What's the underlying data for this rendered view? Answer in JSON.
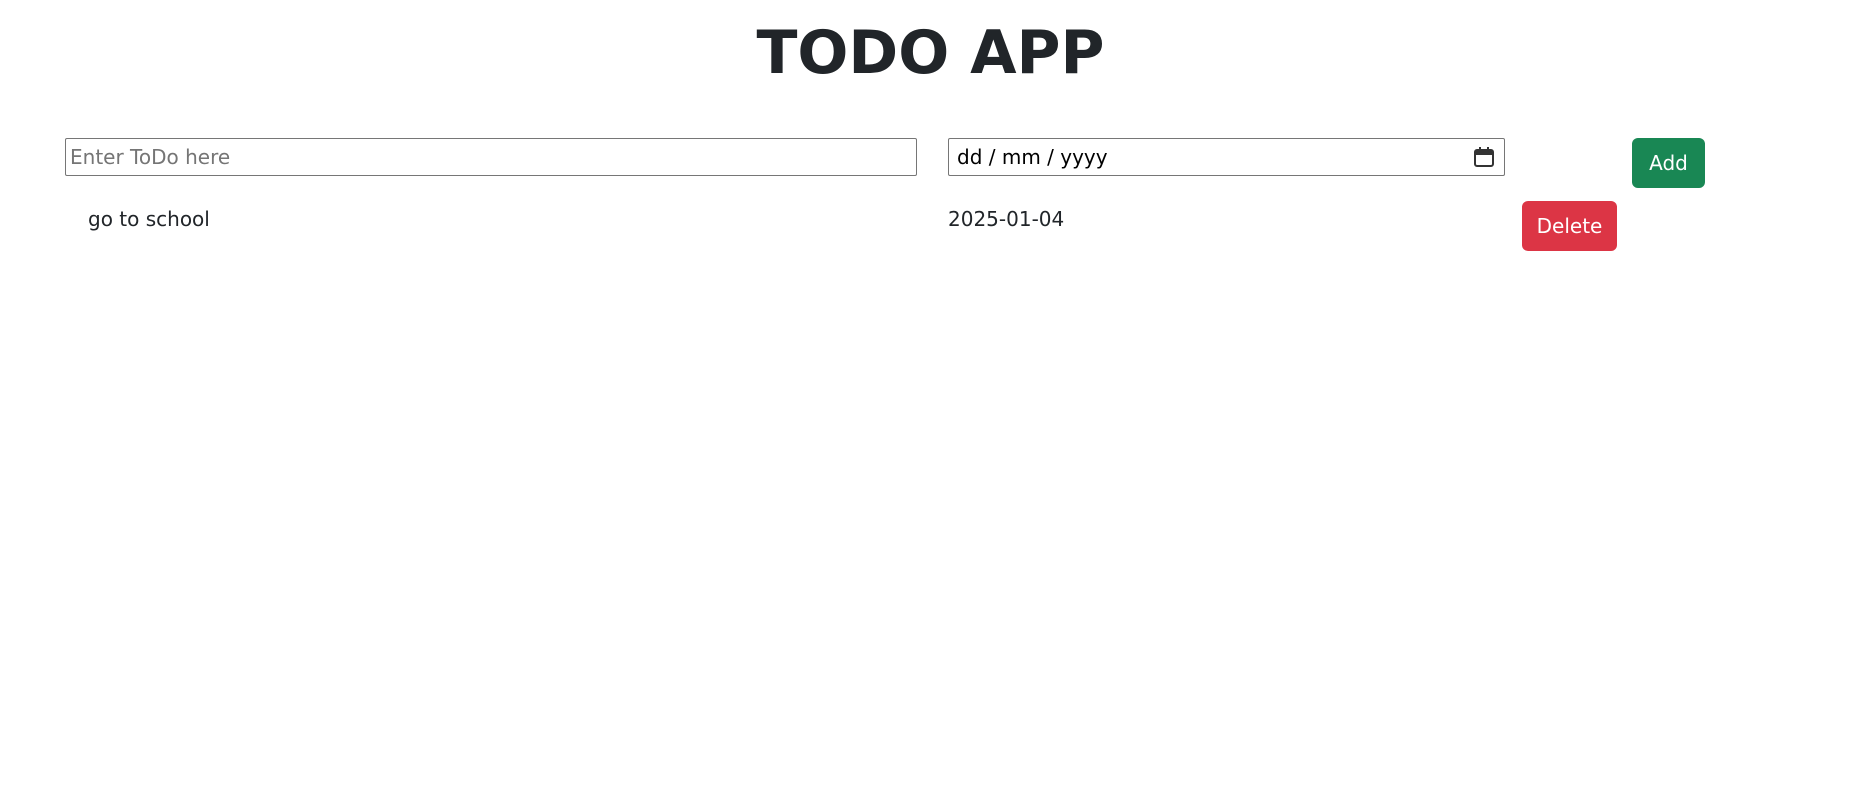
{
  "app": {
    "title": "TODO APP"
  },
  "form": {
    "todo_placeholder": "Enter ToDo here",
    "todo_value": "",
    "date_placeholder": "dd / mm / yyyy",
    "date_value": "",
    "add_label": "Add"
  },
  "todos": [
    {
      "text": "go to school",
      "date": "2025-01-04",
      "delete_label": "Delete"
    }
  ],
  "icons": {
    "date_picker": "calendar-icon"
  },
  "colors": {
    "add_button": "#198754",
    "delete_button": "#dc3545",
    "text": "#212529"
  }
}
